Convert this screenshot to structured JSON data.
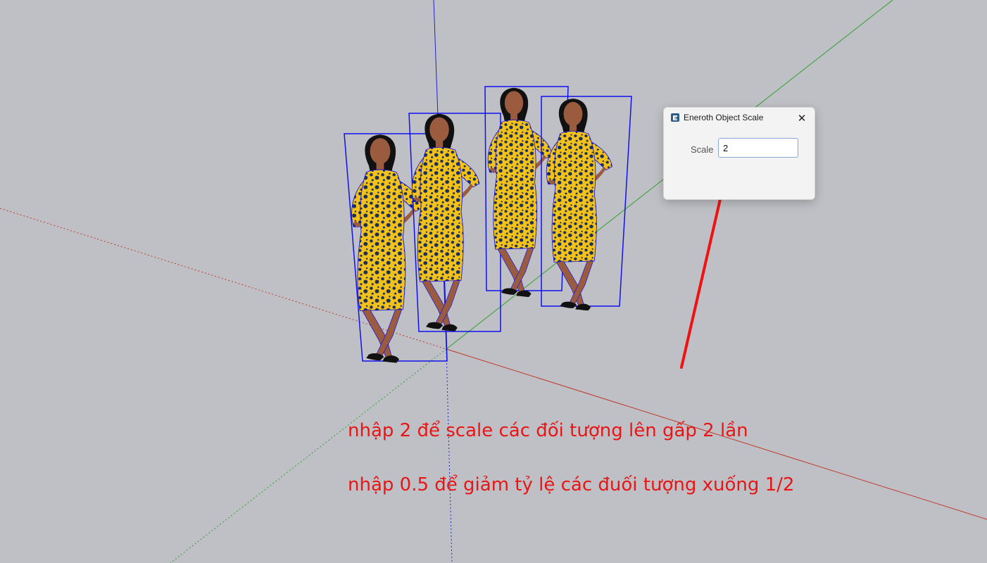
{
  "dialog": {
    "title": "Eneroth Object Scale",
    "close_label": "✕",
    "scale_label": "Scale",
    "scale_value": "2",
    "icon": "eneroth-app-icon"
  },
  "annotations": {
    "note_scale_up": "nhập 2 để scale các đối tượng lên gấp 2 lần",
    "note_scale_down": "nhập 0.5 để giảm tỷ lệ các đuối tượng xuống 1/2"
  },
  "colors": {
    "background": "#bfc0c5",
    "red_axis": "#c0392b",
    "green_axis": "#2ea02e",
    "blue_axis": "#2222cc",
    "selection": "#1010ee",
    "dress_yellow": "#f2c21b",
    "dress_dots": "#1a2f5c",
    "skin": "#9a5b3f",
    "hair": "#111111",
    "annotation": "#e81616"
  }
}
